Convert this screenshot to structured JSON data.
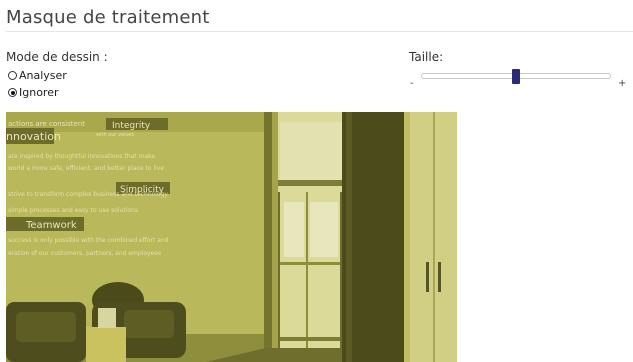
{
  "panel": {
    "title": "Masque de traitement"
  },
  "mode": {
    "label": "Mode de dessin :",
    "options": [
      {
        "label": "Analyser",
        "checked": false
      },
      {
        "label": "Ignorer",
        "checked": true
      }
    ]
  },
  "size": {
    "label": "Taille:",
    "min_label": "-",
    "max_label": "+",
    "value_fraction": 0.5
  },
  "image": {
    "overlay_color": "#c8c23a",
    "wall_text": {
      "line1": "actions are consistent",
      "line1b": "with our values",
      "integrity": "Integrity",
      "innovation": "nnovation",
      "line2": "are inspired by thoughtful innovations that make",
      "line3": "world a more safe, efficient, and better place to live",
      "simplicity": "Simplicity",
      "line4": "strive to transform complex business and technology",
      "line5": "simple processes and easy to use solutions",
      "teamwork": "Teamwork",
      "line6": "success is only possible with the combined effort and",
      "line7": "eration of our customers, partners, and employees"
    }
  }
}
